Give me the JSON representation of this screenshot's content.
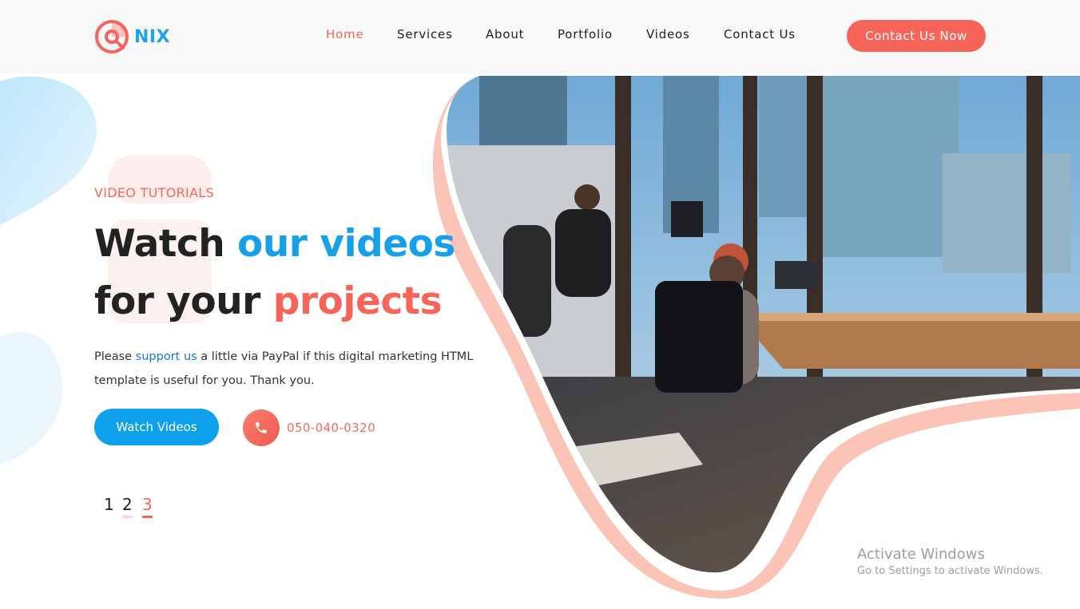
{
  "header": {
    "logo_text": "NIX",
    "nav": [
      {
        "label": "Home",
        "active": true
      },
      {
        "label": "Services",
        "active": false
      },
      {
        "label": "About",
        "active": false
      },
      {
        "label": "Portfolio",
        "active": false
      },
      {
        "label": "Videos",
        "active": false
      },
      {
        "label": "Contact Us",
        "active": false
      }
    ],
    "cta_label": "Contact Us Now"
  },
  "hero": {
    "eyebrow": "VIDEO TUTORIALS",
    "headline": {
      "line1_a": "Watch ",
      "line1_b": "our videos",
      "line2_a": "for your ",
      "line2_b": "projects"
    },
    "description": {
      "before": "Please ",
      "link": "support us",
      "after": " a little via PayPal if this digital marketing HTML template is useful for you. Thank you."
    },
    "watch_button": "Watch Videos",
    "phone": "050-040-0320",
    "pager": [
      "1",
      "2",
      "3"
    ],
    "active_page": "3"
  },
  "os_overlay": {
    "title": "Activate Windows",
    "subtitle": "Go to Settings to activate Windows."
  },
  "colors": {
    "accent_coral": "#f7655a",
    "accent_blue": "#16a0e8",
    "text_dark": "#222222"
  },
  "icons": [
    "nix-logo-icon",
    "phone-icon"
  ]
}
